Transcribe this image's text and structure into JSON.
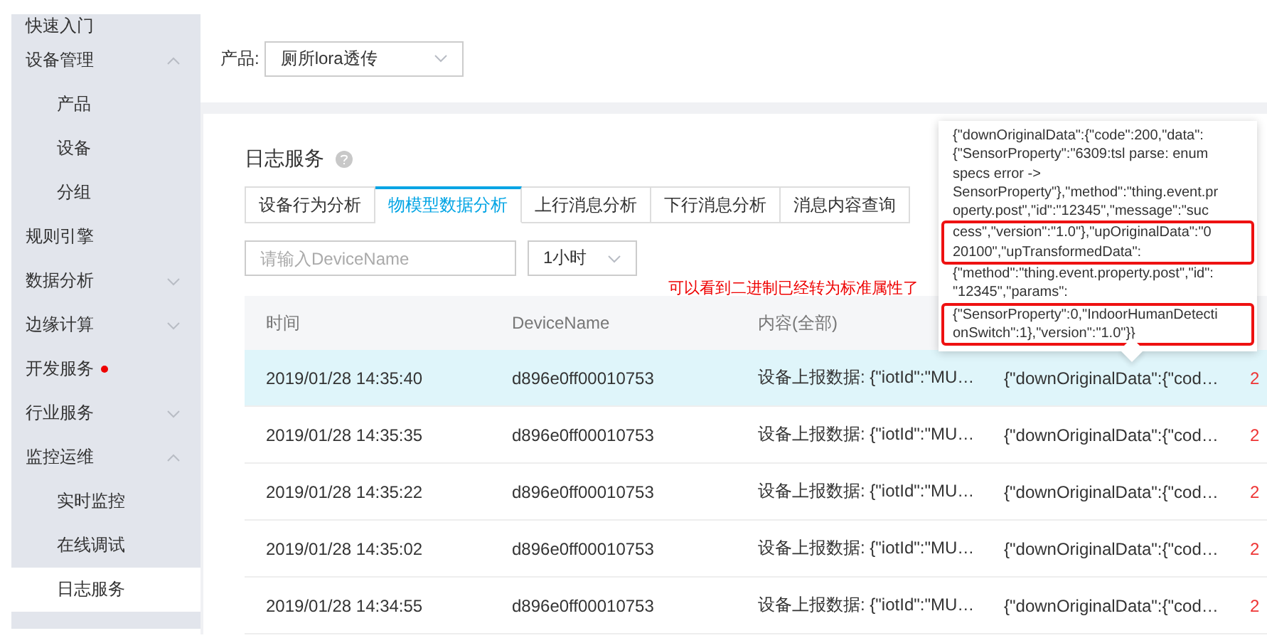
{
  "sidebar": {
    "items": [
      {
        "label": "快速入门",
        "selected": false
      },
      {
        "label": "设备管理",
        "expanded": true,
        "selected": false,
        "children": [
          {
            "label": "产品",
            "selected": false
          },
          {
            "label": "设备",
            "selected": false
          },
          {
            "label": "分组",
            "selected": false
          }
        ]
      },
      {
        "label": "规则引擎",
        "selected": false
      },
      {
        "label": "数据分析",
        "expanded": false,
        "selected": false
      },
      {
        "label": "边缘计算",
        "expanded": false,
        "selected": false
      },
      {
        "label": "开发服务",
        "selected": false,
        "new": true
      },
      {
        "label": "行业服务",
        "expanded": false,
        "selected": false
      },
      {
        "label": "监控运维",
        "expanded": true,
        "selected": false,
        "children": [
          {
            "label": "实时监控",
            "selected": false
          },
          {
            "label": "在线调试",
            "selected": false
          },
          {
            "label": "日志服务",
            "selected": true
          }
        ]
      }
    ]
  },
  "product": {
    "label": "产品:",
    "value": "厕所lora透传"
  },
  "panel": {
    "title": "日志服务",
    "tabs": [
      {
        "label": "设备行为分析",
        "selected": false
      },
      {
        "label": "物模型数据分析",
        "selected": true
      },
      {
        "label": "上行消息分析",
        "selected": false
      },
      {
        "label": "下行消息分析",
        "selected": false
      },
      {
        "label": "消息内容查询",
        "selected": false
      }
    ],
    "search": {
      "placeholder": "请输入DeviceName"
    },
    "range": {
      "value": "1小时"
    },
    "annotation": "可以看到二进制已经转为标准属性了",
    "table": {
      "columns": [
        "时间",
        "DeviceName",
        "内容(全部)"
      ],
      "rows": [
        {
          "selected": true,
          "cells": [
            "2019/01/28 14:35:40",
            "d896e0ff00010753",
            "设备上报数据: {\"iotId\":\"MU…",
            "{\"downOriginalData\":{\"cod…",
            "2"
          ]
        },
        {
          "selected": false,
          "cells": [
            "2019/01/28 14:35:35",
            "d896e0ff00010753",
            "设备上报数据: {\"iotId\":\"MU…",
            "{\"downOriginalData\":{\"cod…",
            "2"
          ]
        },
        {
          "selected": false,
          "cells": [
            "2019/01/28 14:35:22",
            "d896e0ff00010753",
            "设备上报数据: {\"iotId\":\"MU…",
            "{\"downOriginalData\":{\"cod…",
            "2"
          ]
        },
        {
          "selected": false,
          "cells": [
            "2019/01/28 14:35:02",
            "d896e0ff00010753",
            "设备上报数据: {\"iotId\":\"MU…",
            "{\"downOriginalData\":{\"cod…",
            "2"
          ]
        },
        {
          "selected": false,
          "cells": [
            "2019/01/28 14:34:55",
            "d896e0ff00010753",
            "设备上报数据: {\"iotId\":\"MU…",
            "{\"downOriginalData\":{\"cod…",
            "2"
          ]
        }
      ]
    }
  },
  "tooltip": {
    "blocks": [
      {
        "highlighted": false,
        "lines": [
          "{\"downOriginalData\":{\"code\":200,\"data\":",
          "{\"SensorProperty\":\"6309:tsl parse: enum",
          "specs error ->",
          "SensorProperty\"},\"method\":\"thing.event.pr",
          "operty.post\",\"id\":\"12345\",\"message\":\"suc"
        ]
      },
      {
        "highlighted": true,
        "lines": [
          "cess\",\"version\":\"1.0\"},\"upOriginalData\":\"0",
          "20100\",\"upTransformedData\":"
        ]
      },
      {
        "highlighted": false,
        "lines": [
          "{\"method\":\"thing.event.property.post\",\"id\":",
          "\"12345\",\"params\":"
        ]
      },
      {
        "highlighted": true,
        "lines": [
          "{\"SensorProperty\":0,\"IndoorHumanDetecti",
          "onSwitch\":1},\"version\":\"1.0\"}}"
        ]
      }
    ]
  }
}
